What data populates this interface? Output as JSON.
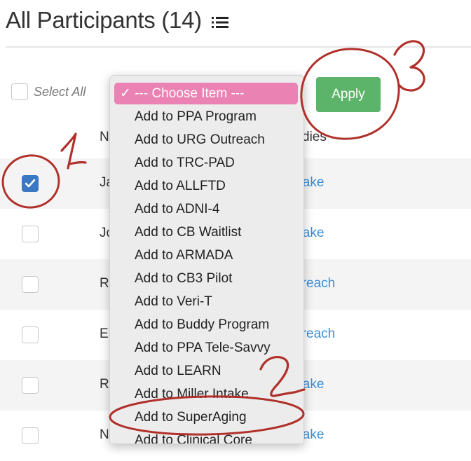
{
  "page": {
    "title": "All Participants (14)",
    "title_icon": "list-icon"
  },
  "toolbar": {
    "select_all_label": "Select All",
    "apply_label": "Apply"
  },
  "table": {
    "col_name_header": "N",
    "col_studies_header": "dies",
    "rows": [
      {
        "name": "Ja",
        "study": "bal Intake",
        "checked": true
      },
      {
        "name": "Jo",
        "study": "bal Intake",
        "checked": false
      },
      {
        "name": "Ru",
        "study": "G Outreach",
        "checked": false
      },
      {
        "name": "Er",
        "study": "G Outreach",
        "checked": false
      },
      {
        "name": "R",
        "study": "bal Intake",
        "checked": false
      },
      {
        "name": "N",
        "study": "bal Intake",
        "checked": false
      }
    ]
  },
  "dropdown": {
    "selected": "✓ --- Choose Item ---",
    "options": [
      "Add to PPA Program",
      "Add to URG Outreach",
      "Add to TRC-PAD",
      "Add to ALLFTD",
      "Add to ADNI-4",
      "Add to CB Waitlist",
      "Add to ARMADA",
      "Add to CB3 Pilot",
      "Add to Veri-T",
      "Add to Buddy Program",
      "Add to PPA Tele-Savvy",
      "Add to LEARN",
      "Add to Miller Intake",
      "Add to SuperAging",
      "Add to Clinical Core"
    ]
  },
  "colors": {
    "accent_green": "#5cb36a",
    "link_blue": "#3a8fd9",
    "checkbox_blue": "#3a78c3",
    "selected_pink": "#ea83b4",
    "annotation_red": "#b0302a"
  },
  "annotations": [
    "1",
    "2",
    "3"
  ]
}
